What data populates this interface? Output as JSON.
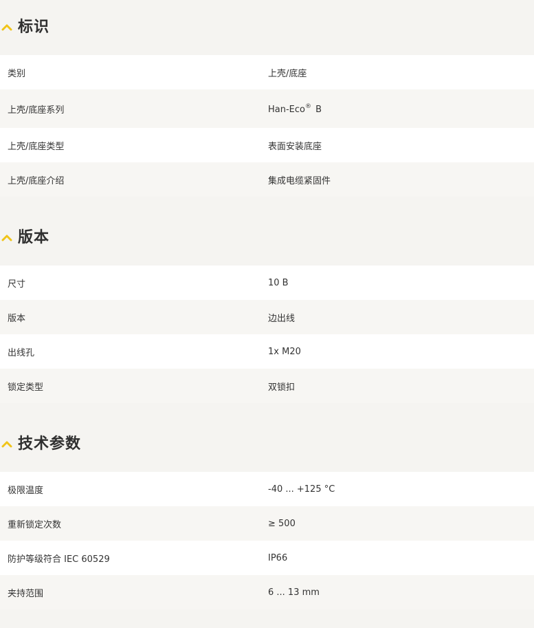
{
  "colors": {
    "accent": "#f0c419",
    "background": "#f5f4f1",
    "row_white": "#ffffff",
    "row_shade": "#f7f6f3",
    "text": "#333333"
  },
  "sections": [
    {
      "title": "标识",
      "icon": "chevron-up-icon",
      "rows": [
        {
          "label": "类别",
          "value": "上壳/底座"
        },
        {
          "label": "上壳/底座系列",
          "value": "Han-Eco",
          "value_sup": "®",
          "value_suffix": " B"
        },
        {
          "label": "上壳/底座类型",
          "value": "表面安装底座"
        },
        {
          "label": "上壳/底座介绍",
          "value": "集成电缆紧固件"
        }
      ]
    },
    {
      "title": "版本",
      "icon": "chevron-up-icon",
      "rows": [
        {
          "label": "尺寸",
          "value": "10 B"
        },
        {
          "label": "版本",
          "value": "边出线"
        },
        {
          "label": "出线孔",
          "value": "1x M20"
        },
        {
          "label": "锁定类型",
          "value": "双锁扣"
        }
      ]
    },
    {
      "title": "技术参数",
      "icon": "chevron-up-icon",
      "rows": [
        {
          "label": "极限温度",
          "value": "-40 ... +125 °C"
        },
        {
          "label": "重新锁定次数",
          "value": "≥ 500"
        },
        {
          "label": "防护等级符合 IEC 60529",
          "value": "IP66"
        },
        {
          "label": "夹持范围",
          "value": "6 ... 13 mm"
        }
      ]
    }
  ]
}
